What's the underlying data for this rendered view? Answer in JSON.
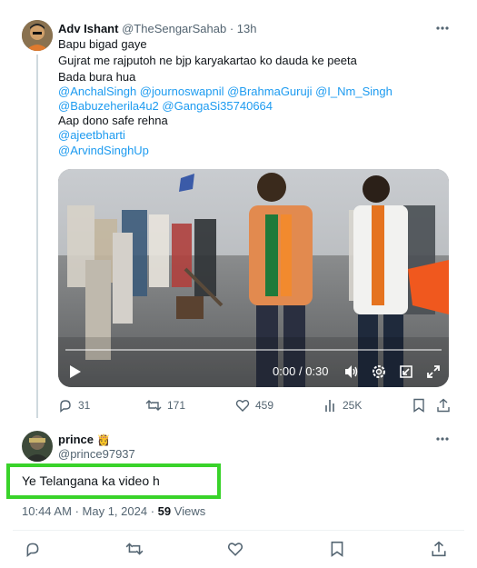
{
  "quoted_tweet": {
    "author_name": "Adv Ishant",
    "author_handle": "@TheSengarSahab",
    "separator": "·",
    "time": "13h",
    "text_lines": [
      "Bapu bigad gaye",
      "Gujrat me rajputoh ne bjp karyakartao ko dauda ke peeta",
      "Bada bura hua"
    ],
    "mentions_line_1": "@AnchalSingh   @journoswapnil @BrahmaGuruji @I_Nm_Singh",
    "mentions_line_2": "@Babuzeherila4u2 @GangaSi35740664",
    "closing_text": "Aap dono safe rehna",
    "mentions_line_3": "@ajeetbharti",
    "mentions_line_4": "@ArvindSinghUp",
    "video": {
      "time_current": "0:00",
      "time_sep": "/",
      "time_total": "0:30"
    },
    "actions": {
      "replies": "31",
      "reposts": "171",
      "likes": "459",
      "views": "25K"
    }
  },
  "reply": {
    "author_name": "prince",
    "author_handle": "@prince97937",
    "text": "Ye Telangana ka video h",
    "time": "10:44 AM",
    "sep": "·",
    "date": "May 1, 2024",
    "views_count": "59",
    "views_label": "Views"
  },
  "colors": {
    "accent": "#1d9bf0",
    "highlight_box": "#39d32a",
    "secondary_text": "#536471"
  }
}
